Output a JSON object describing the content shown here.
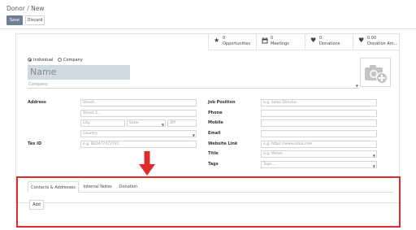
{
  "breadcrumb": {
    "parent": "Donor",
    "separator": "/",
    "current": "New"
  },
  "toolbar": {
    "save_label": "Save",
    "discard_label": "Discard"
  },
  "stat_buttons": [
    {
      "value": "0",
      "label": "Opportunities",
      "icon": "star-icon"
    },
    {
      "value": "0",
      "label": "Meetings",
      "icon": "calendar-icon"
    },
    {
      "value": "0",
      "label": "Donations",
      "icon": "heart-icon"
    },
    {
      "value": "0.00",
      "label": "Donation Am...",
      "icon": "heart-icon"
    }
  ],
  "partner_type": {
    "individual_label": "Individual",
    "company_label": "Company",
    "selected": "Individual"
  },
  "name_placeholder": "Name",
  "company_placeholder": "Company",
  "address": {
    "label": "Address",
    "street": "Street...",
    "street2": "Street 2...",
    "city": "City",
    "state": "State",
    "zip": "ZIP",
    "country": "Country"
  },
  "tax_id": {
    "label": "Tax ID",
    "placeholder": "e.g. BE0477472701"
  },
  "right_fields": {
    "job_position": {
      "label": "Job Position",
      "placeholder": "e.g. Sales Director"
    },
    "phone": {
      "label": "Phone"
    },
    "mobile": {
      "label": "Mobile"
    },
    "email": {
      "label": "Email"
    },
    "website": {
      "label": "Website Link",
      "placeholder": "e.g. https://www.odoo.com"
    },
    "title": {
      "label": "Title",
      "placeholder": "e.g. Mister"
    },
    "tags": {
      "label": "Tags",
      "placeholder": "Tags..."
    }
  },
  "tabs": [
    {
      "label": "Contacts & Addresses",
      "active": true
    },
    {
      "label": "Internal Notes",
      "active": false
    },
    {
      "label": "Donation",
      "active": false
    }
  ],
  "add_label": "Add",
  "colors": {
    "save": "#6d7f95",
    "highlight": "#e02b2b",
    "name_bg": "#cfd9e2"
  }
}
